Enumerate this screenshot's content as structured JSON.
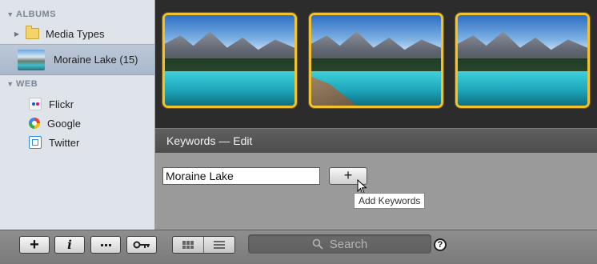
{
  "sidebar": {
    "albums_header": "ALBUMS",
    "media_types": "Media Types",
    "selected_album": "Moraine Lake (15)",
    "web_header": "WEB",
    "services": [
      "Flickr",
      "Google",
      "Twitter"
    ]
  },
  "photos": [
    "Moraine Lake photo 1",
    "Moraine Lake photo 2",
    "Moraine Lake photo 3"
  ],
  "keywords": {
    "title": "Keywords — Edit",
    "input_value": "Moraine Lake",
    "add_button_label": "+",
    "tooltip": "Add Keywords"
  },
  "toolbar": {
    "add_label": "+",
    "info_label": "i",
    "search_placeholder": "Search",
    "help_label": "?"
  },
  "colors": {
    "selection_border": "#f2c22e",
    "sidebar_bg": "#dfe4eb",
    "panel_bg": "#9a9a9a"
  }
}
